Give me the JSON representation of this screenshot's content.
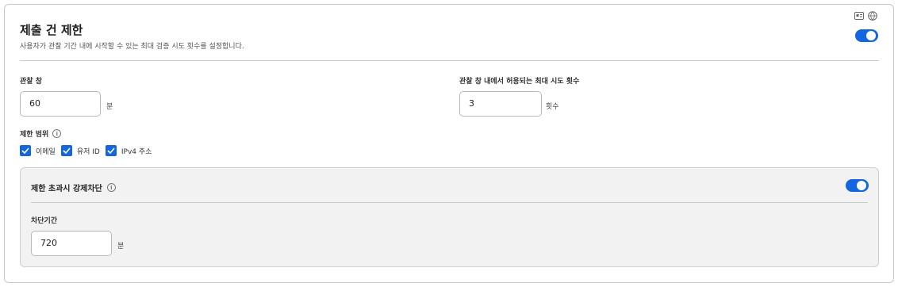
{
  "section": {
    "title": "제출 건 제한",
    "description": "사용자가 관찰 기간 내에 시작할 수 있는 최대 검증 시도 횟수를 설정합니다.",
    "enabled": true
  },
  "top_icons": [
    "id-card-icon",
    "globe-icon"
  ],
  "observation_window": {
    "label": "관찰 창",
    "value": "60",
    "unit": "분"
  },
  "max_attempts": {
    "label": "관찰 창 내에서 허용되는 최대 시도 횟수",
    "value": "3",
    "unit": "횟수"
  },
  "scope": {
    "label": "제한 범위",
    "options": [
      {
        "label": "이메일",
        "checked": true
      },
      {
        "label": "유저 ID",
        "checked": true
      },
      {
        "label": "IPv4 주소",
        "checked": true
      }
    ]
  },
  "block_panel": {
    "title": "제한 초과시 강제차단",
    "enabled": true,
    "duration": {
      "label": "차단기간",
      "value": "720",
      "unit": "분"
    }
  },
  "colors": {
    "accent": "#1465e0",
    "border": "#c8c8c8",
    "panel_bg": "#f2f2f2"
  }
}
